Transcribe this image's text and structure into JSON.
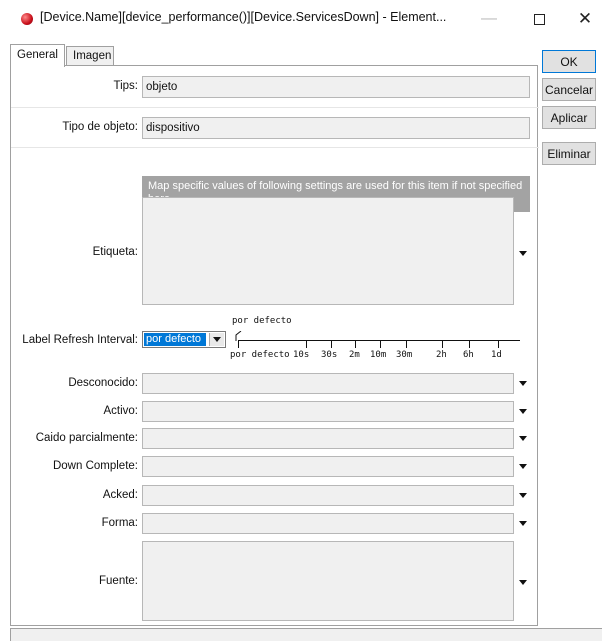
{
  "window": {
    "title": "[Device.Name][device_performance()][Device.ServicesDown] - Element..."
  },
  "tabs": [
    {
      "label": "General"
    },
    {
      "label": "Imagen"
    }
  ],
  "side_buttons": {
    "ok": "OK",
    "cancel": "Cancelar",
    "apply": "Aplicar",
    "delete": "Eliminar"
  },
  "form": {
    "tips": {
      "label": "Tips:",
      "value": "objeto"
    },
    "object_type": {
      "label": "Tipo de objeto:",
      "value": "dispositivo"
    },
    "info_text": "Map specific values of following settings are used for this item if not specified here",
    "etiqueta": {
      "label": "Etiqueta:"
    },
    "refresh": {
      "label": "Label Refresh Interval:",
      "selected": "por defecto",
      "slider_label": "por defecto",
      "ticks": [
        "por defecto",
        "10s",
        "30s",
        "2m",
        "10m",
        "30m",
        "2h",
        "6h",
        "1d"
      ]
    },
    "desconocido": {
      "label": "Desconocido:"
    },
    "activo": {
      "label": "Activo:"
    },
    "caido_parcial": {
      "label": "Caido parcialmente:"
    },
    "down_complete": {
      "label": "Down Complete:"
    },
    "acked": {
      "label": "Acked:"
    },
    "forma": {
      "label": "Forma:"
    },
    "fuente": {
      "label": "Fuente:"
    }
  }
}
